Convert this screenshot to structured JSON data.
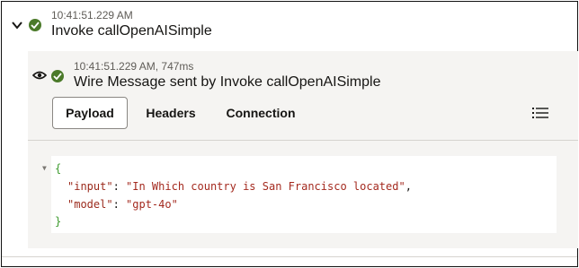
{
  "header": {
    "timestamp": "10:41:51.229 AM",
    "title": "Invoke callOpenAISimple"
  },
  "detail": {
    "timestamp": "10:41:51.229 AM, 747ms",
    "title": "Wire Message sent by Invoke callOpenAISimple"
  },
  "tabs": [
    {
      "label": "Payload",
      "selected": true
    },
    {
      "label": "Headers",
      "selected": false
    },
    {
      "label": "Connection",
      "selected": false
    }
  ],
  "payload": {
    "open_brace": "{",
    "close_brace": "}",
    "fields": [
      {
        "key": "\"input\"",
        "value": "\"In Which country is San Francisco located\"",
        "trailing": ","
      },
      {
        "key": "\"model\"",
        "value": "\"gpt-4o\"",
        "trailing": ""
      }
    ]
  },
  "icons": {
    "expand": "chevron-down-icon",
    "status": "check-circle-icon",
    "view": "eye-icon",
    "list": "list-icon",
    "fold": "fold-triangle-icon"
  },
  "colors": {
    "success": "#4b7a2a",
    "panel_bg": "#f5f4f2",
    "json_brace": "#3c9a2c",
    "json_string": "#a42a1f"
  }
}
